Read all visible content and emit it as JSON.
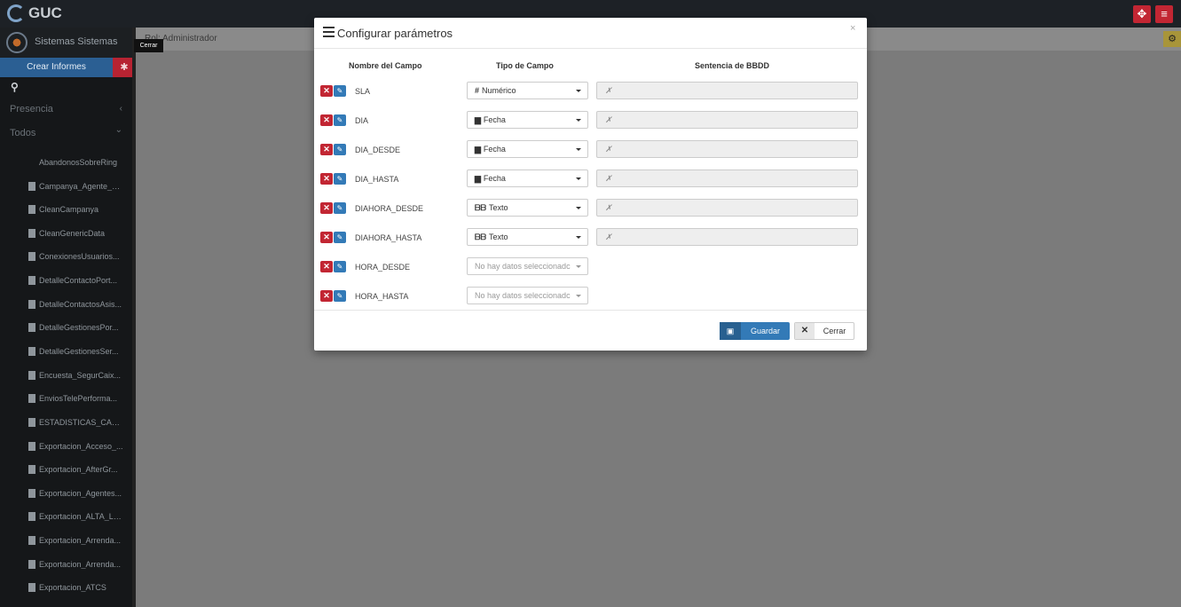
{
  "app": {
    "title": "GUC"
  },
  "sidebar": {
    "user_name": "Sistemas Sistemas",
    "crear_label": "Crear Informes",
    "nav": [
      {
        "label": "Presencia",
        "chevron": "‹"
      },
      {
        "label": "Todos",
        "chevron": "⌄"
      }
    ],
    "reports": [
      "AbandonosSobreRing",
      "Campanya_Agente_D...",
      "CleanCampanya",
      "CleanGenericData",
      "ConexionesUsuarios...",
      "DetalleContactoPort...",
      "DetalleContactosAsis...",
      "DetalleGestionesPor...",
      "DetalleGestionesSer...",
      "Encuesta_SegurCaix...",
      "EnviosTelePerforma...",
      "ESTADISTICAS_CAMP...",
      "Exportacion_Acceso_...",
      "Exportacion_AfterGr...",
      "Exportacion_Agentes...",
      "Exportacion_ALTA_LL...",
      "Exportacion_Arrenda...",
      "Exportacion_Arrenda...",
      "Exportacion_ATCS"
    ]
  },
  "tooltip": "Cerrar",
  "breadcrumb": "Rol: Administrador",
  "modal": {
    "title": "Configurar parámetros",
    "close": "×",
    "columns": {
      "name": "Nombre del Campo",
      "type": "Tipo de Campo",
      "sql": "Sentencia de BBDD"
    },
    "rows": [
      {
        "name": "SLA",
        "type_icon": "#",
        "type": "Numérico",
        "sql": "✗"
      },
      {
        "name": "DIA",
        "type_icon": "▆",
        "type": "Fecha",
        "sql": "✗"
      },
      {
        "name": "DIA_DESDE",
        "type_icon": "▆",
        "type": "Fecha",
        "sql": "✗"
      },
      {
        "name": "DIA_HASTA",
        "type_icon": "▆",
        "type": "Fecha",
        "sql": "✗"
      },
      {
        "name": "DIAHORA_DESDE",
        "type_icon": "ᗷᗷ",
        "type": "Texto",
        "sql": "✗"
      },
      {
        "name": "DIAHORA_HASTA",
        "type_icon": "ᗷᗷ",
        "type": "Texto",
        "sql": "✗"
      },
      {
        "name": "HORA_DESDE",
        "type_icon": "",
        "type": "No hay datos seleccionadc",
        "sql": ""
      },
      {
        "name": "HORA_HASTA",
        "type_icon": "",
        "type": "No hay datos seleccionadc",
        "sql": ""
      }
    ],
    "save_label": "Guardar",
    "cancel_label": "Cerrar"
  },
  "colors": {
    "danger": "#c22633",
    "primary": "#337ab7",
    "sidebar": "#151719"
  }
}
